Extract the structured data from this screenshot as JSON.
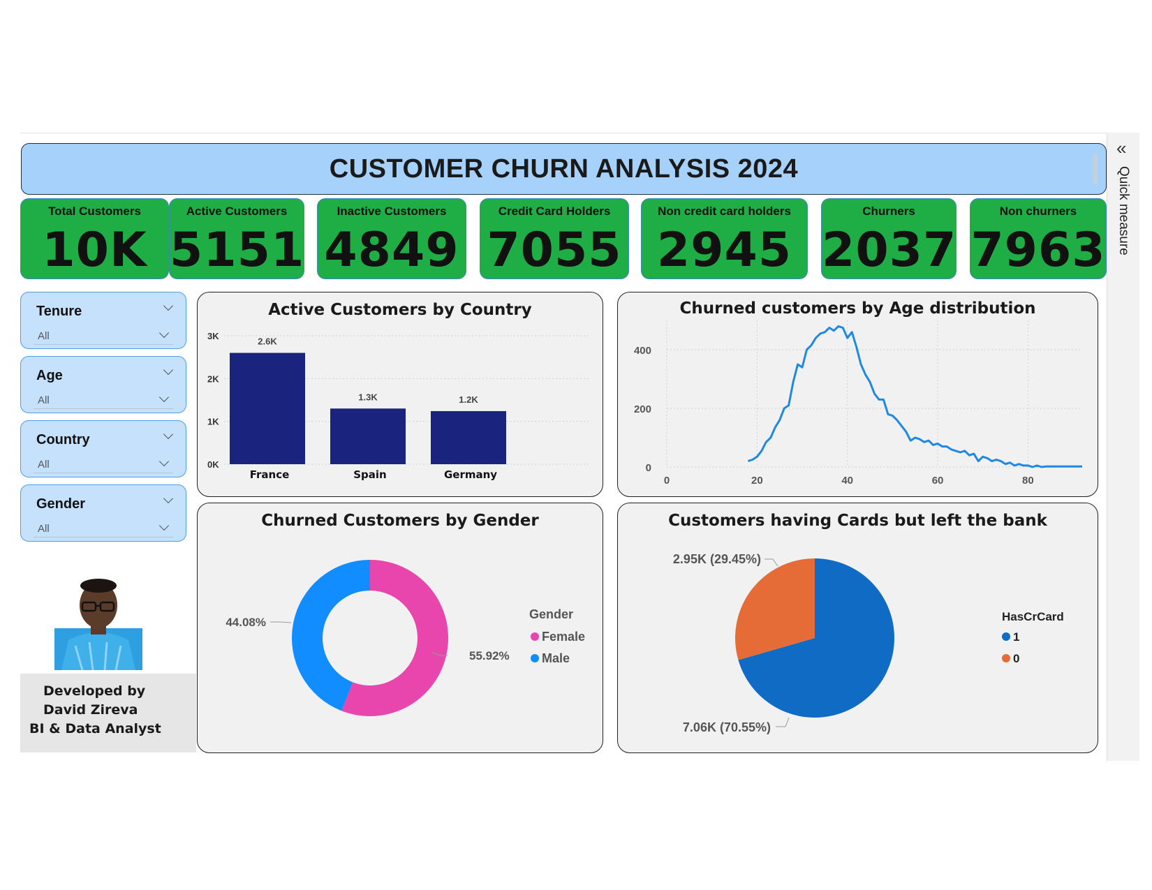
{
  "header": {
    "title": "CUSTOMER CHURN ANALYSIS 2024"
  },
  "side_pane": {
    "label": "Quick measure",
    "collapse_icon": "double-chevron-left-icon"
  },
  "kpis": [
    {
      "label": "Total Customers",
      "value": "10K"
    },
    {
      "label": "Active Customers",
      "value": "5151"
    },
    {
      "label": "Inactive Customers",
      "value": "4849"
    },
    {
      "label": "Credit Card Holders",
      "value": "7055"
    },
    {
      "label": "Non credit card holders",
      "value": "2945"
    },
    {
      "label": "Churners",
      "value": "2037"
    },
    {
      "label": "Non churners",
      "value": "7963"
    }
  ],
  "slicers": [
    {
      "title": "Tenure",
      "value": "All"
    },
    {
      "title": "Age",
      "value": "All"
    },
    {
      "title": "Country",
      "value": "All"
    },
    {
      "title": "Gender",
      "value": "All"
    }
  ],
  "developer": {
    "line1": "Developed by",
    "line2": "David Zireva",
    "line3": "BI & Data Analyst"
  },
  "colors": {
    "kpi_bg": "#1fae45",
    "banner_bg": "#a6d1fb",
    "bar": "#1a237e",
    "line": "#1e88e5",
    "female": "#e845ad",
    "male": "#118dff",
    "card1": "#0f6bc4",
    "card0": "#e66c37"
  },
  "chart_data": [
    {
      "type": "bar",
      "title": "Active Customers by Country",
      "categories": [
        "France",
        "Spain",
        "Germany"
      ],
      "values": [
        2600,
        1300,
        1240
      ],
      "data_labels": [
        "2.6K",
        "1.3K",
        "1.2K"
      ],
      "yticks": [
        "0K",
        "1K",
        "2K",
        "3K"
      ],
      "ylim": [
        0,
        3000
      ],
      "grid": true
    },
    {
      "type": "line",
      "title": "Churned customers by Age distribution",
      "x": [
        18,
        19,
        20,
        21,
        22,
        23,
        24,
        25,
        26,
        27,
        28,
        29,
        30,
        31,
        32,
        33,
        34,
        35,
        36,
        37,
        38,
        39,
        40,
        41,
        42,
        43,
        44,
        45,
        46,
        47,
        48,
        49,
        50,
        51,
        52,
        53,
        54,
        55,
        56,
        57,
        58,
        59,
        60,
        61,
        62,
        63,
        64,
        65,
        66,
        67,
        68,
        69,
        70,
        71,
        72,
        73,
        74,
        75,
        76,
        77,
        78,
        79,
        80,
        81,
        82,
        83,
        84,
        92
      ],
      "y": [
        20,
        25,
        35,
        55,
        85,
        100,
        135,
        160,
        200,
        210,
        290,
        350,
        340,
        400,
        415,
        440,
        455,
        460,
        475,
        465,
        480,
        475,
        440,
        460,
        410,
        350,
        315,
        290,
        250,
        230,
        230,
        180,
        175,
        160,
        140,
        120,
        90,
        100,
        95,
        85,
        90,
        75,
        80,
        70,
        70,
        60,
        55,
        50,
        55,
        40,
        45,
        20,
        35,
        30,
        20,
        25,
        20,
        10,
        15,
        5,
        10,
        5,
        5,
        0,
        5,
        0,
        2,
        2
      ],
      "xticks": [
        0,
        20,
        40,
        60,
        80
      ],
      "yticks": [
        0,
        200,
        400
      ],
      "xlim": [
        0,
        92
      ],
      "ylim": [
        0,
        500
      ],
      "grid": true
    },
    {
      "type": "pie",
      "title": "Churned Customers by Gender",
      "legend_title": "Gender",
      "slices": [
        {
          "name": "Female",
          "value": 55.92,
          "label": "55.92%"
        },
        {
          "name": "Male",
          "value": 44.08,
          "label": "44.08%"
        }
      ],
      "donut": true,
      "legend": "right"
    },
    {
      "type": "pie",
      "title": "Customers having Cards but left the bank",
      "legend_title": "HasCrCard",
      "slices": [
        {
          "name": "1",
          "value": 70.55,
          "label": "7.06K (70.55%)"
        },
        {
          "name": "0",
          "value": 29.45,
          "label": "2.95K (29.45%)"
        }
      ],
      "donut": false,
      "legend": "right"
    }
  ]
}
